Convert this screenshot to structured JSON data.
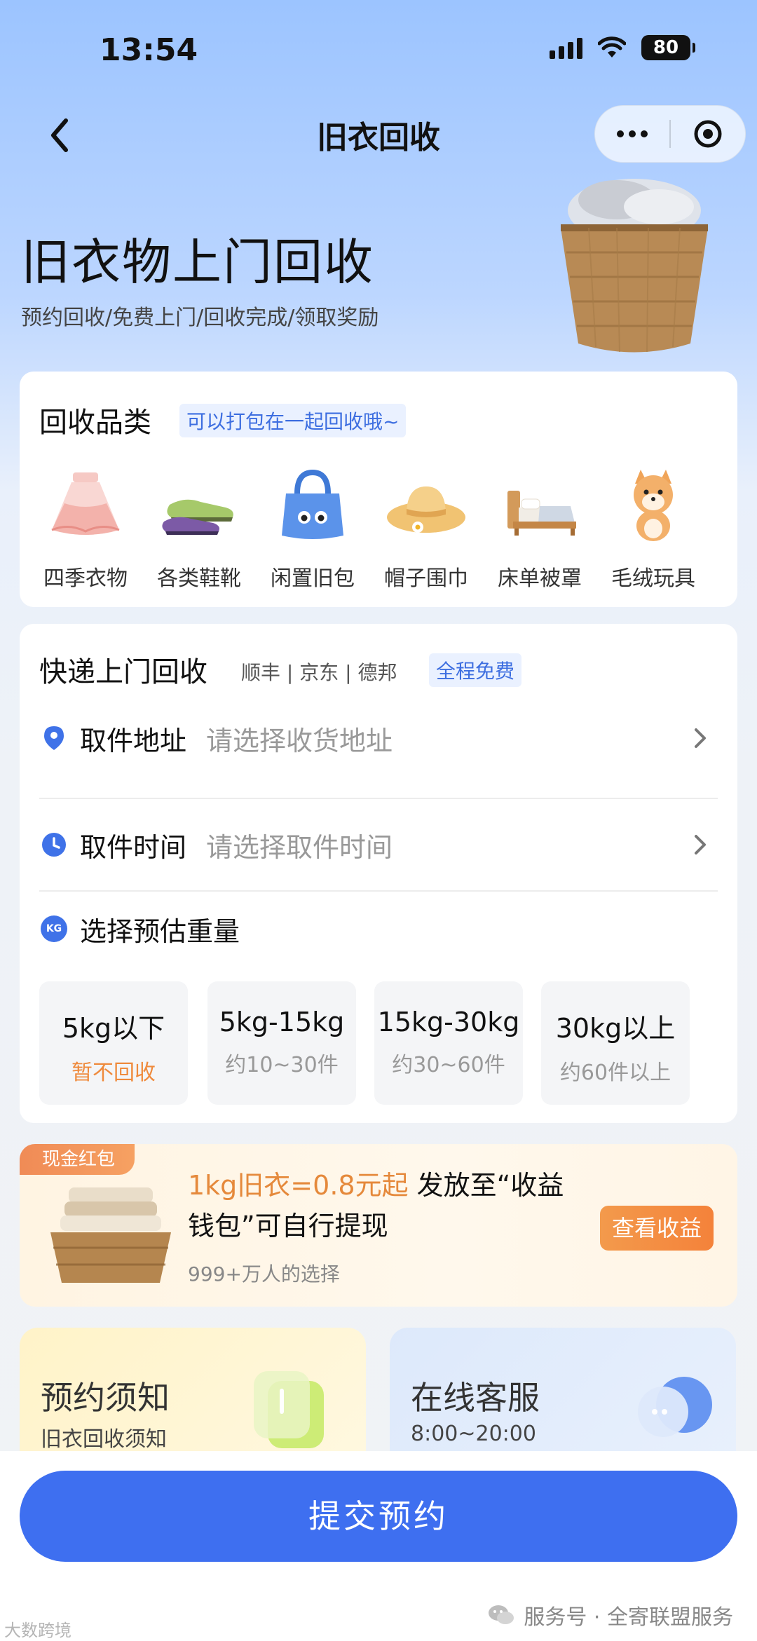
{
  "status_bar": {
    "time": "13:54",
    "battery": "80"
  },
  "nav": {
    "title": "旧衣回收"
  },
  "hero": {
    "title": "旧衣物上门回收",
    "subtitle": "预约回收/免费上门/回收完成/领取奖励"
  },
  "categories": {
    "title": "回收品类",
    "tag": "可以打包在一起回收哦~",
    "items": [
      {
        "label": "四季衣物",
        "icon": "skirt-icon"
      },
      {
        "label": "各类鞋靴",
        "icon": "shoes-icon"
      },
      {
        "label": "闲置旧包",
        "icon": "bag-icon"
      },
      {
        "label": "帽子围巾",
        "icon": "hat-icon"
      },
      {
        "label": "床单被罩",
        "icon": "bed-icon"
      },
      {
        "label": "毛绒玩具",
        "icon": "plush-toy-icon"
      }
    ]
  },
  "express": {
    "title": "快递上门回收",
    "carriers": "顺丰 | 京东 | 德邦",
    "free_tag": "全程免费",
    "address": {
      "label": "取件地址",
      "placeholder": "请选择收货地址"
    },
    "time": {
      "label": "取件时间",
      "placeholder": "请选择取件时间"
    },
    "weight_title": "选择预估重量",
    "kg_badge": "KG",
    "weights": [
      {
        "value": "5kg以下",
        "sub": "暂不回收"
      },
      {
        "value": "5kg-15kg",
        "sub": "约10~30件"
      },
      {
        "value": "15kg-30kg",
        "sub": "约30~60件"
      },
      {
        "value": "30kg以上",
        "sub": "约60件以上"
      }
    ]
  },
  "reward": {
    "tag": "现金红包",
    "highlight": "1kg旧衣=0.8元起",
    "text": " 发放至“收益钱包”可自行提现",
    "sub": "999+万人的选择",
    "button": "查看收益"
  },
  "tiles": {
    "notice": {
      "title": "预约须知",
      "sub": "旧衣回收须知"
    },
    "service": {
      "title": "在线客服",
      "sub": "8:00~20:00"
    }
  },
  "submit": "提交预约",
  "watermark": {
    "left": "大数跨境",
    "right": "服务号 · 全寄联盟服务"
  },
  "colors": {
    "primary": "#3e6ff0",
    "orange": "#f4823a",
    "tag_bg": "#eaf1ff"
  }
}
